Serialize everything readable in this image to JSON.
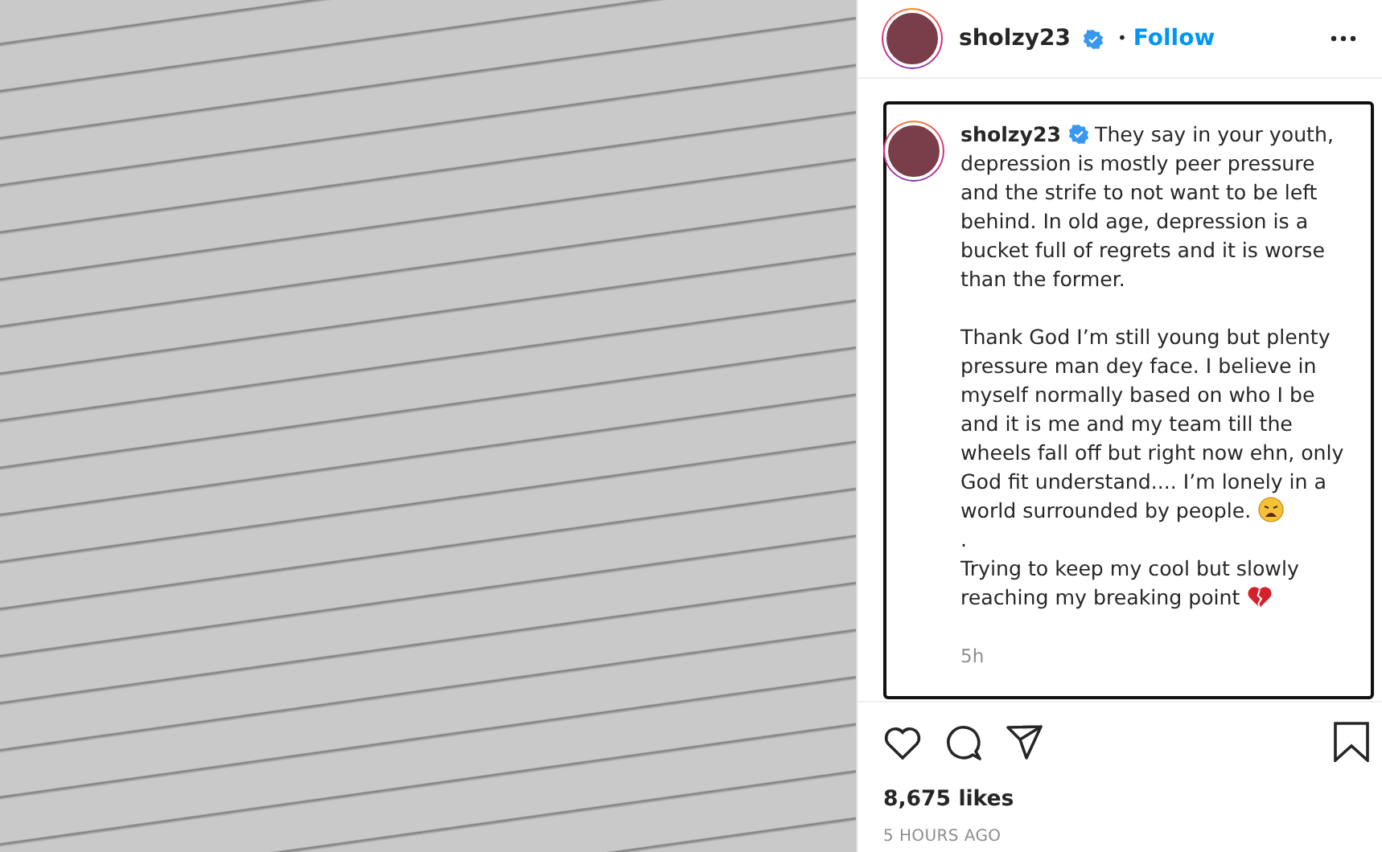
{
  "post": {
    "author": {
      "username": "sholzy23",
      "verified": true,
      "follow_label": "Follow",
      "separator": "•"
    },
    "caption": {
      "username": "sholzy23",
      "verified": true,
      "paragraphs": [
        {
          "segments": [
            {
              "text": "They say in your youth, depression is mostly peer pressure and the strife to not want to be left behind. In old age, depression is a bucket full of regrets and it is worse than the former."
            }
          ]
        },
        {
          "segments": [
            {
              "text": "Thank God I’m still young but plenty pressure man dey face. I believe in myself normally based on who I be and it is me and my team till the wheels fall off but right now ehn, only God fit understand.... I’m lonely in a world surrounded by people.",
              "kind": "weary"
            },
            {
              "text": "."
            },
            {
              "text": "Trying to keep my cool but slowly reaching my breaking point",
              "kind": "broken_heart"
            }
          ]
        }
      ],
      "time": "5h"
    },
    "likes": "8,675 likes",
    "posted": "5 HOURS AGO"
  }
}
